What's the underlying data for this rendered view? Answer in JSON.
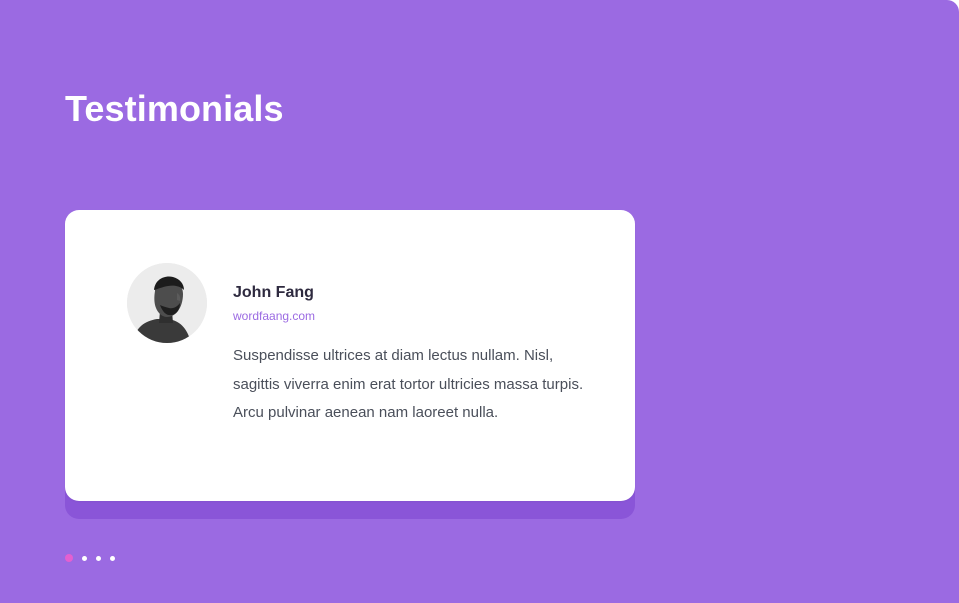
{
  "page": {
    "title": "Testimonials",
    "background_color": "#9b6ae2"
  },
  "testimonial": {
    "name": "John Fang",
    "website": "wordfaang.com",
    "quote": "Suspendisse ultrices at diam lectus nullam. Nisl, sagittis viverra enim erat tortor ultricies massa turpis. Arcu pulvinar aenean nam laoreet nulla.",
    "avatar_icon": "person-portrait"
  },
  "pagination": {
    "count": 4,
    "active_index": 0,
    "active_color": "#e460d0",
    "inactive_color": "#ffffff"
  }
}
